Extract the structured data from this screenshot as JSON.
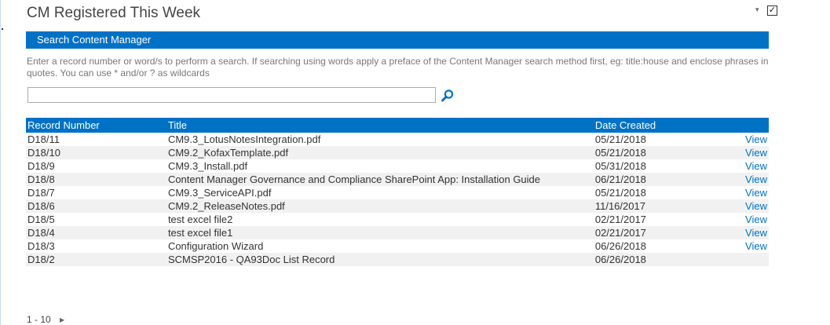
{
  "webpart": {
    "title": "CM Registered This Week",
    "menu_icon": "dropdown-arrow-icon",
    "checkbox_checked": true,
    "checkbox_mark": "✓"
  },
  "search": {
    "header": "Search Content Manager",
    "instructions": "Enter a record number or word/s to perform a search. If searching using words apply a preface of the Content Manager search method first, eg: title:house and enclose phrases in quotes. You can use * and/or ? as wildcards",
    "input_value": "",
    "input_placeholder": "",
    "button_icon": "magnifier-icon"
  },
  "table": {
    "headers": {
      "record_number": "Record Number",
      "title": "Title",
      "date_created": "Date Created",
      "action": ""
    },
    "rows": [
      {
        "record_number": "D18/11",
        "title": "CM9.3_LotusNotesIntegration.pdf",
        "date_created": "05/21/2018",
        "action": "View"
      },
      {
        "record_number": "D18/10",
        "title": "CM9.2_KofaxTemplate.pdf",
        "date_created": "05/21/2018",
        "action": "View"
      },
      {
        "record_number": "D18/9",
        "title": "CM9.3_Install.pdf",
        "date_created": "05/31/2018",
        "action": "View"
      },
      {
        "record_number": "D18/8",
        "title": "Content Manager Governance and Compliance SharePoint App: Installation Guide",
        "date_created": "06/21/2018",
        "action": "View"
      },
      {
        "record_number": "D18/7",
        "title": "CM9.3_ServiceAPI.pdf",
        "date_created": "05/21/2018",
        "action": "View"
      },
      {
        "record_number": "D18/6",
        "title": "CM9.2_ReleaseNotes.pdf",
        "date_created": "11/16/2017",
        "action": "View"
      },
      {
        "record_number": "D18/5",
        "title": "test excel file2",
        "date_created": "02/21/2017",
        "action": "View"
      },
      {
        "record_number": "D18/4",
        "title": "test excel file1",
        "date_created": "02/21/2017",
        "action": "View"
      },
      {
        "record_number": "D18/3",
        "title": "Configuration Wizard",
        "date_created": "06/26/2018",
        "action": "View"
      },
      {
        "record_number": "D18/2",
        "title": "SCMSP2016 - QA93Doc List Record",
        "date_created": "06/26/2018",
        "action": ""
      }
    ]
  },
  "pager": {
    "range": "1 - 10",
    "next_icon": "next-page-arrow-icon"
  },
  "colors": {
    "accent": "#0072c6",
    "header_text": "#ffffff",
    "alt_row": "#f1f1f1",
    "link": "#0072c6"
  }
}
